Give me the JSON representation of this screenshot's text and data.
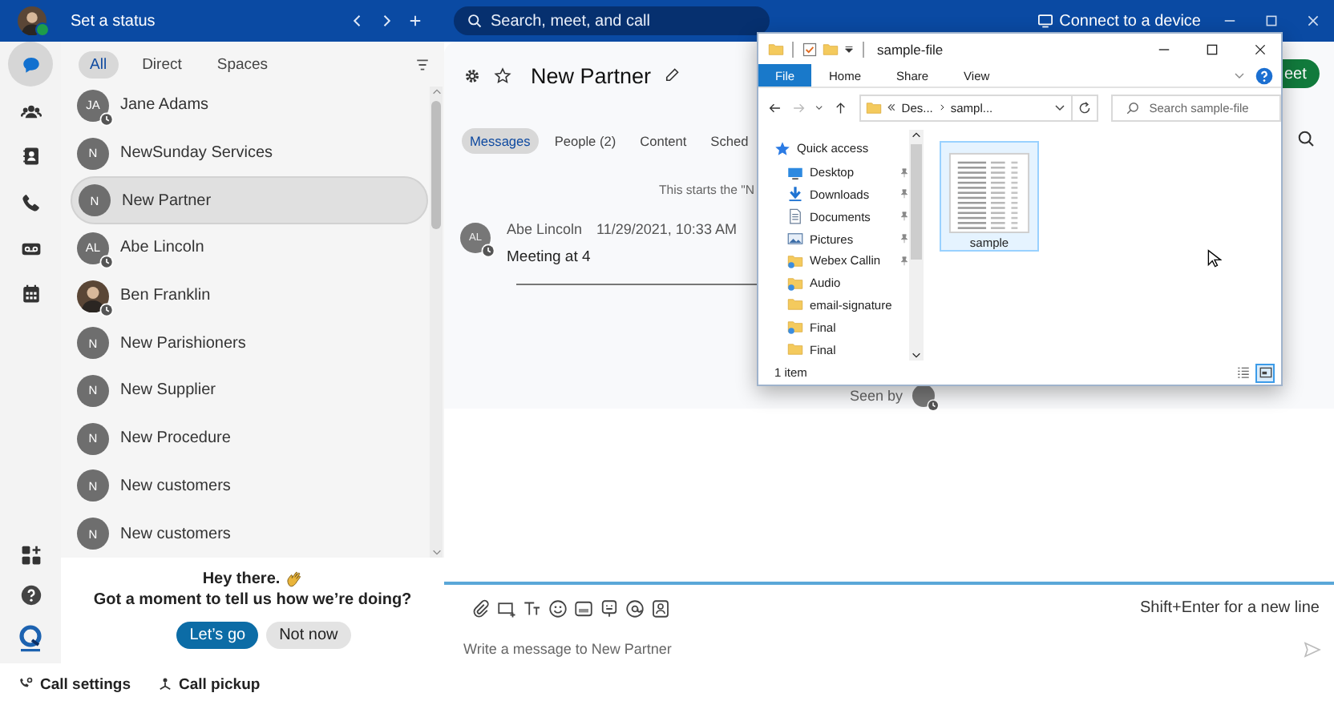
{
  "top_bar": {
    "status": "Set a status",
    "search_placeholder": "Search, meet, and call",
    "connect": "Connect to a device"
  },
  "rail": [
    {
      "kind": "chat",
      "selected": true
    },
    {
      "kind": "teams",
      "selected": false
    },
    {
      "kind": "contacts",
      "selected": false
    },
    {
      "kind": "calls",
      "selected": false
    },
    {
      "kind": "voicemail",
      "selected": false
    },
    {
      "kind": "calendar",
      "selected": false
    }
  ],
  "filters": [
    {
      "label": "All",
      "selected": true
    },
    {
      "label": "Direct",
      "selected": false
    },
    {
      "label": "Spaces",
      "selected": false
    }
  ],
  "chats": [
    {
      "name": "Jane Adams",
      "initials": "JA",
      "kind": "initials",
      "away": true,
      "selected": false
    },
    {
      "name": "NewSunday Services",
      "initials": "N",
      "kind": "initials",
      "away": false,
      "selected": false
    },
    {
      "name": "New Partner",
      "initials": "N",
      "kind": "initials",
      "away": false,
      "selected": true
    },
    {
      "name": "Abe Lincoln",
      "initials": "AL",
      "kind": "initials",
      "away": true,
      "selected": false
    },
    {
      "name": "Ben Franklin",
      "kind": "photo",
      "away": true,
      "selected": false
    },
    {
      "name": "New Parishioners",
      "initials": "N",
      "kind": "initials",
      "away": false,
      "selected": false
    },
    {
      "name": "New Supplier",
      "initials": "N",
      "kind": "initials",
      "away": false,
      "selected": false
    },
    {
      "name": "New Procedure",
      "initials": "N",
      "kind": "initials",
      "away": false,
      "selected": false
    },
    {
      "name": "New customers",
      "initials": "N",
      "kind": "initials",
      "away": false,
      "selected": false
    },
    {
      "name": "New customers",
      "initials": "N",
      "kind": "initials",
      "away": false,
      "selected": false
    }
  ],
  "survey": {
    "greeting": "Hey there.",
    "question": "Got a moment to tell us how we’re doing?",
    "buttons": [
      {
        "label": "Let’s go",
        "kind": "primary"
      },
      {
        "label": "Not now",
        "kind": "secondary"
      }
    ]
  },
  "footer": [
    {
      "label": "Call settings",
      "kind": "settings"
    },
    {
      "label": "Call pickup",
      "kind": "pickup"
    }
  ],
  "conversation": {
    "title": "New Partner",
    "meet": "eet",
    "tabs": [
      {
        "label": "Messages",
        "selected": true
      },
      {
        "label": "People (2)",
        "selected": false
      },
      {
        "label": "Content",
        "selected": false
      },
      {
        "label": "Sched",
        "selected": false
      }
    ],
    "intro": "This starts the \"N",
    "message": {
      "author": "Abe Lincoln",
      "initials": "AL",
      "time": "11/29/2021, 10:33 AM",
      "text": "Meeting at 4"
    },
    "seen_by": "Seen by",
    "composer": {
      "hint": "Shift+Enter for a new line",
      "placeholder": "Write a message to New Partner"
    }
  },
  "explorer": {
    "title": "sample-file",
    "ribbon": [
      {
        "label": "File",
        "kind": "file-menu"
      },
      {
        "label": "Home",
        "kind": "tab"
      },
      {
        "label": "Share",
        "kind": "tab"
      },
      {
        "label": "View",
        "kind": "tab"
      }
    ],
    "path": [
      "Des...",
      "sampl..."
    ],
    "search_placeholder": "Search sample-file",
    "nav": [
      {
        "label": "Quick access",
        "kind": "star",
        "pinned": false
      },
      {
        "label": "Desktop",
        "kind": "desktop",
        "pinned": true
      },
      {
        "label": "Downloads",
        "kind": "downloads",
        "pinned": true
      },
      {
        "label": "Documents",
        "kind": "documents",
        "pinned": true
      },
      {
        "label": "Pictures",
        "kind": "pictures",
        "pinned": true
      },
      {
        "label": "Webex Callin",
        "kind": "shared-folder",
        "pinned": true
      },
      {
        "label": "Audio",
        "kind": "shared-folder",
        "pinned": false
      },
      {
        "label": "email-signature",
        "kind": "folder",
        "pinned": false
      },
      {
        "label": "Final",
        "kind": "shared-folder",
        "pinned": false
      },
      {
        "label": "Final",
        "kind": "folder",
        "pinned": false
      }
    ],
    "files": [
      {
        "name": "sample",
        "selected": true
      }
    ],
    "status": "1 item",
    "views": [
      {
        "kind": "details",
        "selected": false
      },
      {
        "kind": "large-icons",
        "selected": true
      }
    ]
  }
}
